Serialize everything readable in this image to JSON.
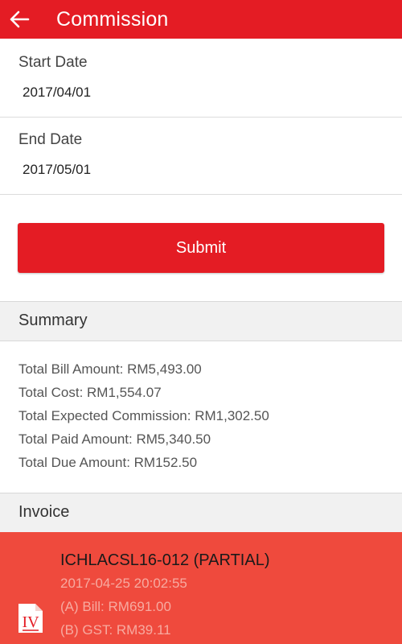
{
  "app_bar": {
    "title": "Commission",
    "back_icon": "arrow-left-icon",
    "color": "#e41c24"
  },
  "form": {
    "start_date_label": "Start Date",
    "start_date_value": "2017/04/01",
    "end_date_label": "End Date",
    "end_date_value": "2017/05/01",
    "submit_label": "Submit"
  },
  "summary": {
    "header": "Summary",
    "lines": [
      "Total Bill Amount: RM5,493.00",
      "Total Cost: RM1,554.07",
      "Total Expected Commission: RM1,302.50",
      "Total Paid Amount: RM5,340.50",
      "Total Due Amount: RM152.50"
    ]
  },
  "invoice": {
    "header": "Invoice",
    "items": [
      {
        "title": "ICHLACSL16-012 (PARTIAL)",
        "datetime": "2017-04-25 20:02:55",
        "bill": "(A) Bill: RM691.00",
        "gst": "(B) GST: RM39.11",
        "icon": "invoice-document-icon",
        "icon_text": "IV",
        "color": "#ef4a3d"
      }
    ]
  }
}
